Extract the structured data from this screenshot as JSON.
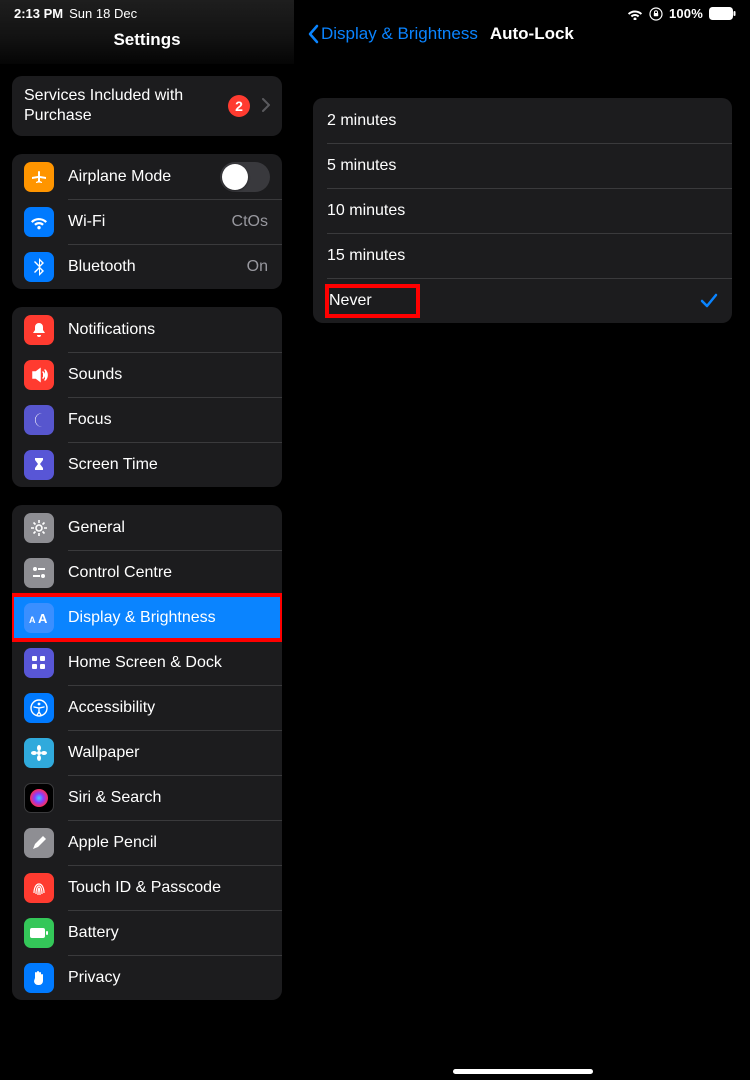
{
  "status": {
    "time": "2:13 PM",
    "date": "Sun 18 Dec",
    "battery": "100%"
  },
  "sidebar": {
    "title": "Settings",
    "top": {
      "services_label": "Services Included with Purchase",
      "services_badge": "2"
    },
    "connect": {
      "airplane": "Airplane Mode",
      "wifi_label": "Wi-Fi",
      "wifi_value": "CtOs",
      "bt_label": "Bluetooth",
      "bt_value": "On"
    },
    "notify": {
      "notifications": "Notifications",
      "sounds": "Sounds",
      "focus": "Focus",
      "screentime": "Screen Time"
    },
    "general": {
      "general": "General",
      "control": "Control Centre",
      "display": "Display & Brightness",
      "home": "Home Screen & Dock",
      "accessibility": "Accessibility",
      "wallpaper": "Wallpaper",
      "siri": "Siri & Search",
      "pencil": "Apple Pencil",
      "touchid": "Touch ID & Passcode",
      "battery": "Battery",
      "privacy": "Privacy"
    }
  },
  "detail": {
    "back": "Display & Brightness",
    "title": "Auto-Lock",
    "options": {
      "o2": "2 minutes",
      "o5": "5 minutes",
      "o10": "10 minutes",
      "o15": "15 minutes",
      "never": "Never"
    }
  }
}
